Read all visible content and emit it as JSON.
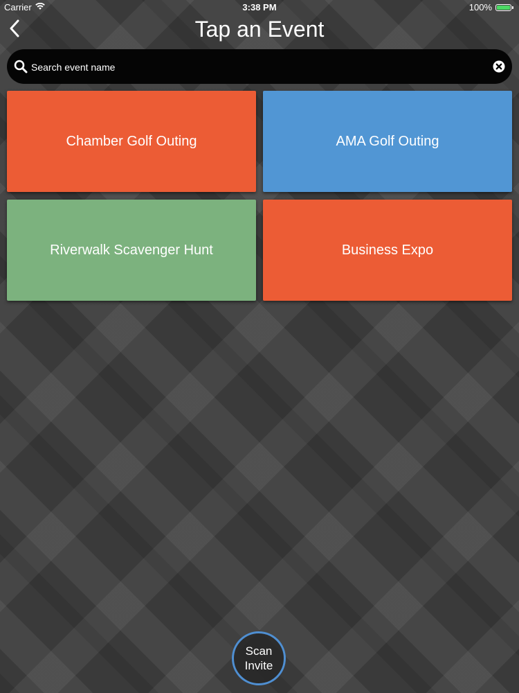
{
  "status_bar": {
    "carrier": "Carrier",
    "time": "3:38 PM",
    "battery": "100%",
    "battery_level": 1.0
  },
  "header": {
    "title": "Tap an Event",
    "back_icon": "chevron-left-icon"
  },
  "search": {
    "placeholder": "Search event name",
    "value": "",
    "search_icon": "search-icon",
    "clear_icon": "clear-icon"
  },
  "events": [
    {
      "label": "Chamber Golf Outing",
      "color": "#ec5c35"
    },
    {
      "label": "AMA Golf Outing",
      "color": "#5196d4"
    },
    {
      "label": "Riverwalk Scavenger Hunt",
      "color": "#7cb27e"
    },
    {
      "label": "Business Expo",
      "color": "#ec5c35"
    }
  ],
  "scan_invite": {
    "label": "Scan\nInvite",
    "ring_color": "#4f8fd2"
  }
}
